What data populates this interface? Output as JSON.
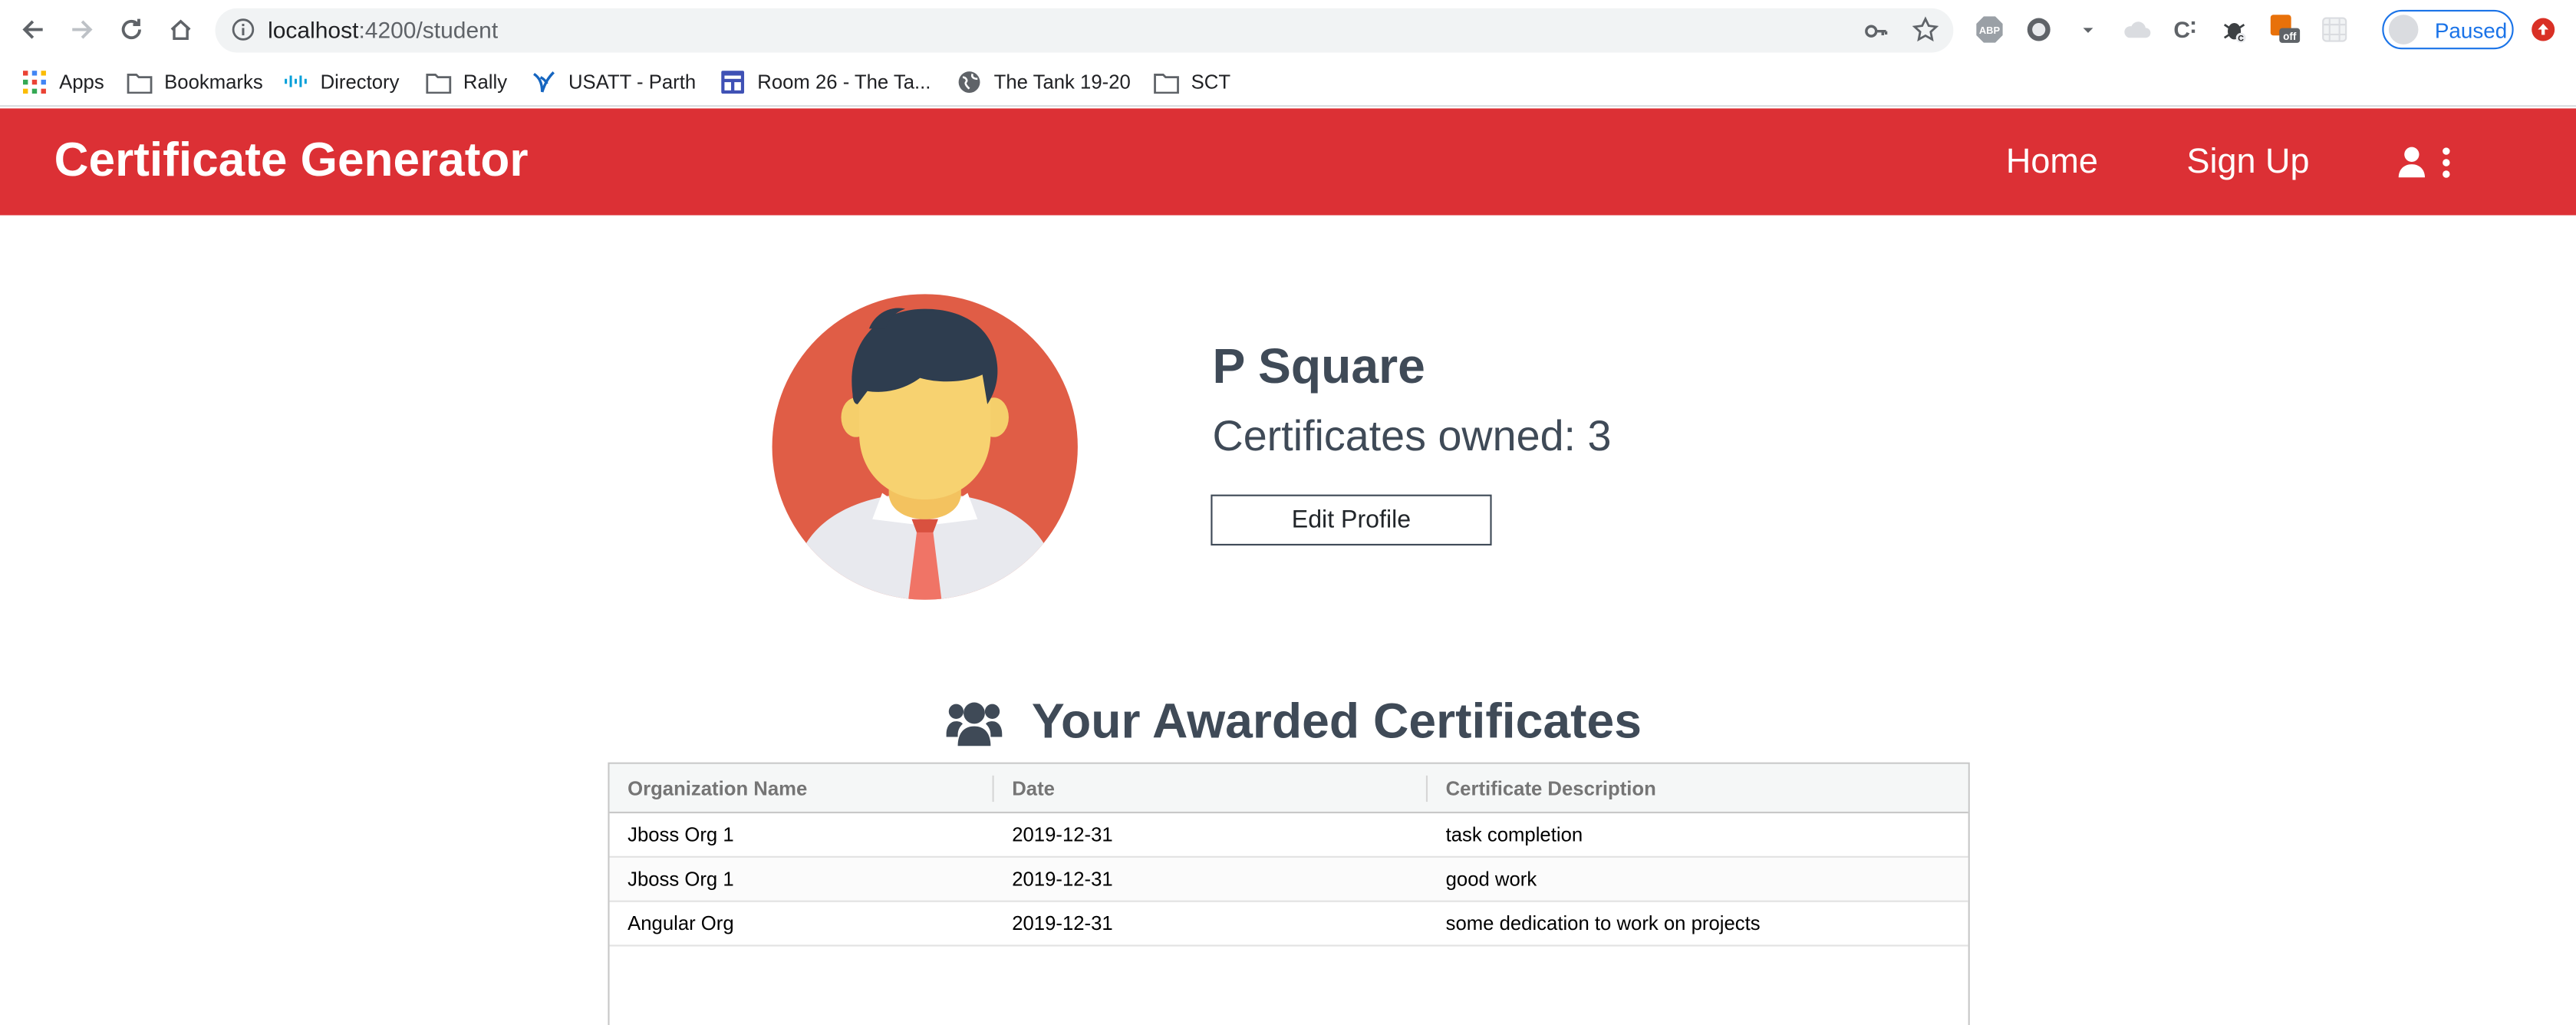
{
  "browser": {
    "url_host": "localhost",
    "url_path": ":4200/student",
    "profile_label": "Paused",
    "bookmarks": [
      {
        "label": "Apps",
        "icon": "apps-grid-icon"
      },
      {
        "label": "Bookmarks",
        "icon": "folder-icon"
      },
      {
        "label": "Directory",
        "icon": "cisco-icon"
      },
      {
        "label": "Rally",
        "icon": "folder-icon"
      },
      {
        "label": "USATT - Parth",
        "icon": "usatt-icon"
      },
      {
        "label": "Room 26 - The Ta...",
        "icon": "classroom-icon"
      },
      {
        "label": "The Tank 19-20",
        "icon": "globe-icon"
      },
      {
        "label": "SCT",
        "icon": "folder-icon"
      }
    ],
    "extensions": [
      {
        "name": "adblock-icon",
        "text": "ABP"
      },
      {
        "name": "dark-reader-icon",
        "text": ""
      },
      {
        "name": "extension-dropdown-icon",
        "text": ""
      },
      {
        "name": "cloud-extension-icon",
        "text": ""
      },
      {
        "name": "c-extension-icon",
        "text": "C"
      },
      {
        "name": "bug-extension-icon",
        "text": ""
      },
      {
        "name": "off-extension-icon",
        "text": "off"
      },
      {
        "name": "grid-extension-icon",
        "text": ""
      }
    ]
  },
  "app": {
    "brand": "Certificate Generator",
    "nav": {
      "home": "Home",
      "signup": "Sign Up"
    },
    "colors": {
      "header_bg": "#dc3035",
      "text_dark": "#3f4a57"
    }
  },
  "profile": {
    "name": "P Square",
    "certificates_owned": "Certificates owned: 3",
    "edit_label": "Edit Profile"
  },
  "certificates": {
    "heading": "Your Awarded Certificates",
    "columns": [
      "Organization Name",
      "Date",
      "Certificate Description"
    ],
    "rows": [
      [
        "Jboss Org 1",
        "2019-12-31",
        "task completion"
      ],
      [
        "Jboss Org 1",
        "2019-12-31",
        "good work"
      ],
      [
        "Angular Org",
        "2019-12-31",
        "some dedication to work on projects"
      ]
    ]
  }
}
